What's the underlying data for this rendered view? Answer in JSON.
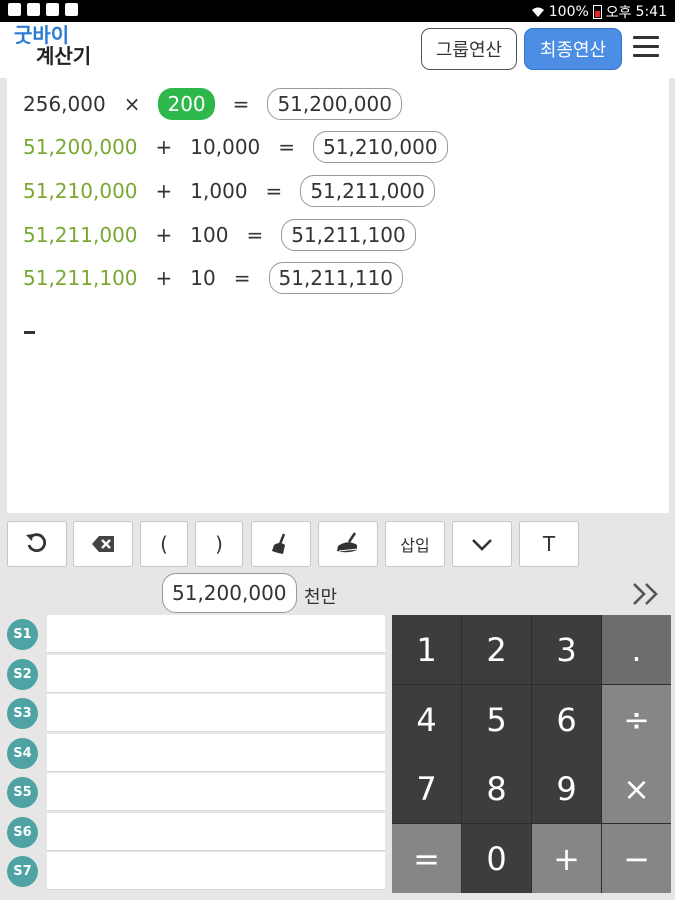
{
  "status_bar": {
    "battery": "100%",
    "ampm": "오후",
    "time": "5:41"
  },
  "header": {
    "logo_top": "굿바이",
    "logo_bottom": "계산기",
    "group_button": "그룹연산",
    "final_button": "최종연산"
  },
  "tape": [
    {
      "left": "256,000",
      "op": "×",
      "right": "200",
      "eq": "=",
      "result": "51,200,000"
    },
    {
      "left": "51,200,000",
      "op": "+",
      "right": "10,000",
      "eq": "=",
      "result": "51,210,000"
    },
    {
      "left": "51,210,000",
      "op": "+",
      "right": "1,000",
      "eq": "=",
      "result": "51,211,000"
    },
    {
      "left": "51,211,000",
      "op": "+",
      "right": "100",
      "eq": "=",
      "result": "51,211,100"
    },
    {
      "left": "51,211,100",
      "op": "+",
      "right": "10",
      "eq": "=",
      "result": "51,211,110"
    }
  ],
  "toolbar": {
    "open_paren": "(",
    "close_paren": ")",
    "insert": "삽입",
    "text": "T"
  },
  "result": {
    "value": "51,200,000",
    "unit": "천만"
  },
  "slots": [
    "S1",
    "S2",
    "S3",
    "S4",
    "S5",
    "S6",
    "S7"
  ],
  "keypad": {
    "k1": "1",
    "k2": "2",
    "k3": "3",
    "dot": ".",
    "k4": "4",
    "k5": "5",
    "k6": "6",
    "div": "÷",
    "k7": "7",
    "k8": "8",
    "k9": "9",
    "mul": "×",
    "eq": "=",
    "k0": "0",
    "plus": "+",
    "minus": "−"
  },
  "colors": {
    "accent_blue": "#4b8ee3",
    "green": "#2eb84c",
    "carry_text": "#7aa832",
    "slot_teal": "#4fa3a4"
  }
}
